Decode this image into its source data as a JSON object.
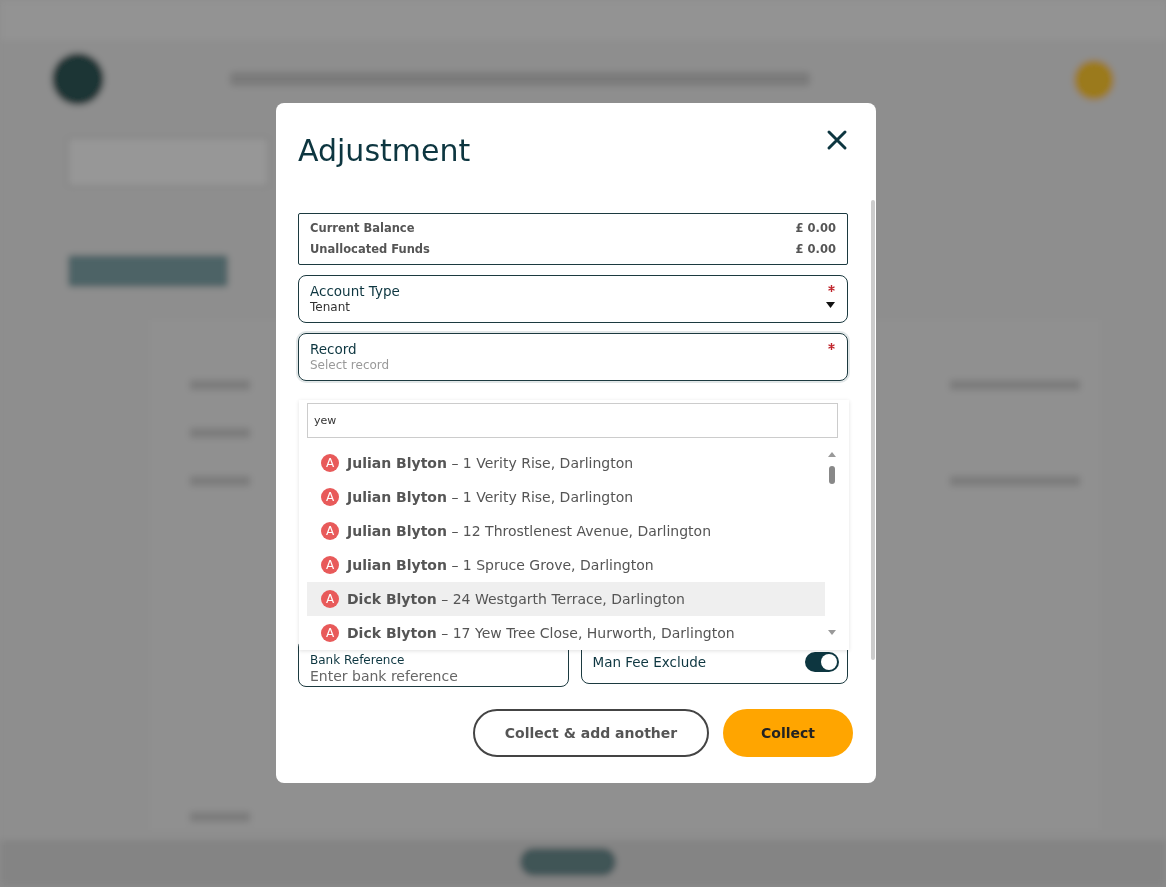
{
  "modal": {
    "title": "Adjustment",
    "balances": [
      {
        "label": "Current Balance",
        "value": "£ 0.00"
      },
      {
        "label": "Unallocated Funds",
        "value": "£ 0.00"
      }
    ],
    "account_type": {
      "label": "Account Type",
      "value": "Tenant",
      "required": true
    },
    "record": {
      "label": "Record",
      "placeholder": "Select record",
      "required": true,
      "expanded": true
    },
    "record_search": {
      "value": "yew"
    },
    "record_options": [
      {
        "badge": "A",
        "name": "Julian Blyton",
        "address": "– 1 Verity Rise, Darlington",
        "selected": false
      },
      {
        "badge": "A",
        "name": "Julian Blyton",
        "address": "– 1 Verity Rise, Darlington",
        "selected": false
      },
      {
        "badge": "A",
        "name": "Julian Blyton",
        "address": "– 12 Throstlenest Avenue, Darlington",
        "selected": false
      },
      {
        "badge": "A",
        "name": "Julian Blyton",
        "address": "– 1 Spruce Grove, Darlington",
        "selected": false
      },
      {
        "badge": "A",
        "name": "Dick Blyton",
        "address": "– 24 Westgarth Terrace, Darlington",
        "selected": true
      },
      {
        "badge": "A",
        "name": "Dick Blyton",
        "address": "– 17 Yew Tree Close, Hurworth, Darlington",
        "selected": false
      }
    ],
    "bank_reference": {
      "label": "Bank Reference",
      "placeholder": "Enter bank reference"
    },
    "man_fee_exclude": {
      "label": "Man Fee Exclude",
      "on": true
    },
    "buttons": [
      {
        "label": "Collect & add another",
        "kind": "secondary"
      },
      {
        "label": "Collect",
        "kind": "primary"
      }
    ]
  }
}
